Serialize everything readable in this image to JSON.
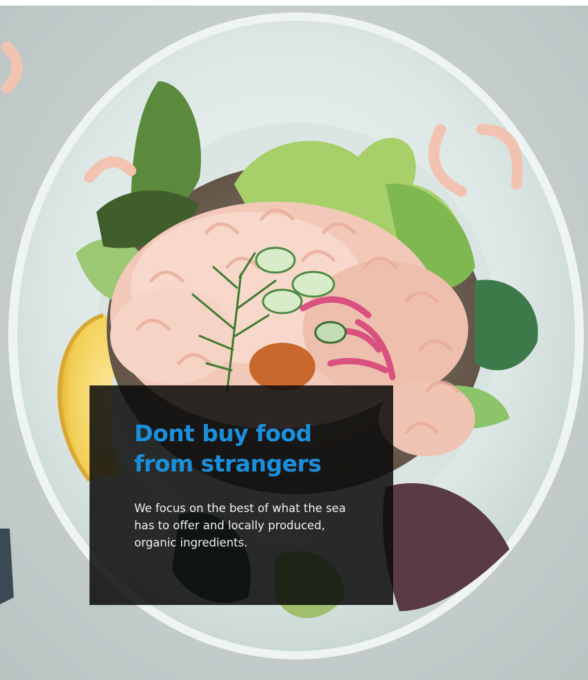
{
  "hero": {
    "image_icon": "seafood-plate-photo",
    "headline": "Dont buy food from strangers",
    "body": "We focus on the best of what the sea has to offer and locally produced, organic ingredients."
  },
  "colors": {
    "headline": "#1a90dc",
    "overlay": "#0a0a0a",
    "body_text": "#f2f2f2",
    "plate": "#dfe9e7",
    "table": "#c9d1d0"
  }
}
